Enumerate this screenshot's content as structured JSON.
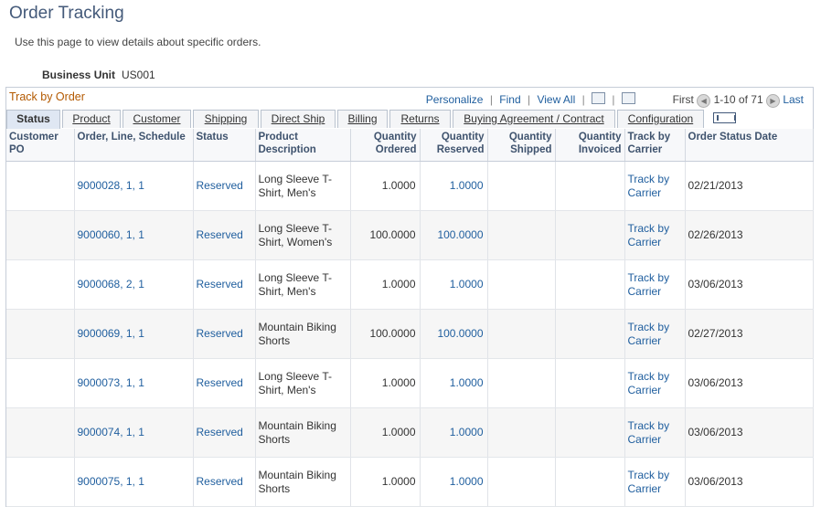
{
  "page": {
    "title": "Order Tracking",
    "instructions": "Use this page to view details about specific orders."
  },
  "business_unit": {
    "label": "Business Unit",
    "value": "US001"
  },
  "grid": {
    "title": "Track by Order",
    "nav": {
      "personalize": "Personalize",
      "find": "Find",
      "view_all": "View All",
      "first": "First",
      "range": "1-10 of 71",
      "last": "Last",
      "sep": "|",
      "icons": [
        "view-in-window-icon",
        "download-spreadsheet-icon",
        "previous-page-icon",
        "next-page-icon"
      ]
    },
    "tabs": [
      "Status",
      "Product",
      "Customer",
      "Shipping",
      "Direct Ship",
      "Billing",
      "Returns",
      "Buying Agreement / Contract",
      "Configuration"
    ],
    "active_tab": "Status",
    "columns": [
      "Customer PO",
      "Order, Line, Schedule",
      "Status",
      "Product Description",
      "Quantity Ordered",
      "Quantity Reserved",
      "Quantity Shipped",
      "Quantity Invoiced",
      "Track by Carrier",
      "Order Status Date"
    ],
    "rows": [
      {
        "customer_po": "",
        "order": "9000028, 1, 1",
        "status": "Reserved",
        "product": "Long Sleeve T-Shirt, Men's",
        "qty_ordered": "1.0000",
        "qty_reserved": "1.0000",
        "qty_shipped": "",
        "qty_invoiced": "",
        "track": "Track by Carrier",
        "date": "02/21/2013"
      },
      {
        "customer_po": "",
        "order": "9000060, 1, 1",
        "status": "Reserved",
        "product": "Long Sleeve T-Shirt, Women's",
        "qty_ordered": "100.0000",
        "qty_reserved": "100.0000",
        "qty_shipped": "",
        "qty_invoiced": "",
        "track": "Track by Carrier",
        "date": "02/26/2013"
      },
      {
        "customer_po": "",
        "order": "9000068, 2, 1",
        "status": "Reserved",
        "product": "Long Sleeve T-Shirt, Men's",
        "qty_ordered": "1.0000",
        "qty_reserved": "1.0000",
        "qty_shipped": "",
        "qty_invoiced": "",
        "track": "Track by Carrier",
        "date": "03/06/2013"
      },
      {
        "customer_po": "",
        "order": "9000069, 1, 1",
        "status": "Reserved",
        "product": "Mountain Biking Shorts",
        "qty_ordered": "100.0000",
        "qty_reserved": "100.0000",
        "qty_shipped": "",
        "qty_invoiced": "",
        "track": "Track by Carrier",
        "date": "02/27/2013"
      },
      {
        "customer_po": "",
        "order": "9000073, 1, 1",
        "status": "Reserved",
        "product": "Long Sleeve T-Shirt, Men's",
        "qty_ordered": "1.0000",
        "qty_reserved": "1.0000",
        "qty_shipped": "",
        "qty_invoiced": "",
        "track": "Track by Carrier",
        "date": "03/06/2013"
      },
      {
        "customer_po": "",
        "order": "9000074, 1, 1",
        "status": "Reserved",
        "product": "Mountain Biking Shorts",
        "qty_ordered": "1.0000",
        "qty_reserved": "1.0000",
        "qty_shipped": "",
        "qty_invoiced": "",
        "track": "Track by Carrier",
        "date": "03/06/2013"
      },
      {
        "customer_po": "",
        "order": "9000075, 1, 1",
        "status": "Reserved",
        "product": "Mountain Biking Shorts",
        "qty_ordered": "1.0000",
        "qty_reserved": "1.0000",
        "qty_shipped": "",
        "qty_invoiced": "",
        "track": "Track by Carrier",
        "date": "03/06/2013"
      }
    ]
  },
  "colors": {
    "title": "#445a7a",
    "link": "#1f5e9e",
    "grid_title": "#b35900",
    "header_text": "#3f536e"
  }
}
